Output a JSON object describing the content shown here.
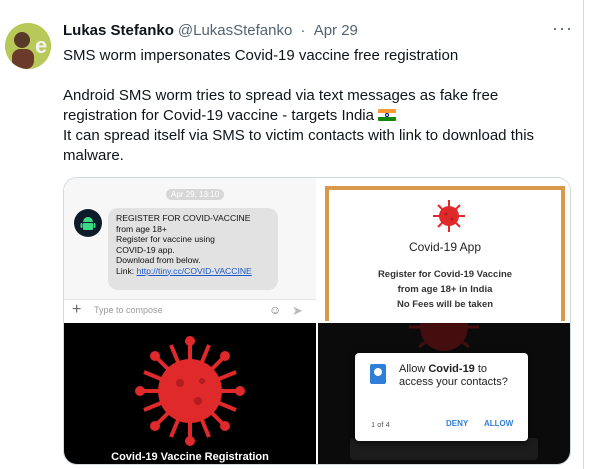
{
  "tweet": {
    "author_name": "Lukas Stefanko",
    "author_handle": "@LukasStefanko",
    "separator": "·",
    "date": "Apr 29",
    "more_icon": "ellipsis-icon",
    "text_line_1": "SMS worm impersonates Covid-19 vaccine free registration",
    "text_para_2_a": "Android SMS worm tries to spread via text messages as fake free registration for Covid-19 vaccine - targets India",
    "flag_icon": "india-flag-icon",
    "text_para_2_b": "It can spread itself via SMS to victim contacts with link to download this malware."
  },
  "media": {
    "sms": {
      "date": "Apr 29, 13:10",
      "lines": [
        "REGISTER FOR COVID-VACCINE",
        "from age 18+",
        "Register for vaccine using",
        "COVID-19 app.",
        "Download from below."
      ],
      "link_prefix": "Link: ",
      "link": "http://tiny.cc/COVID-VACCINE",
      "compose_placeholder": "Type to compose"
    },
    "app_poster": {
      "title": "Covid-19 App",
      "line_1": "Register for Covid-19 Vaccine",
      "line_2": "from age 18+ in India",
      "line_3": "No Fees will be taken"
    },
    "splash": {
      "caption": "Covid-19 Vaccine Registration"
    },
    "permission_dialog": {
      "text_before": "Allow ",
      "app_name": "Covid-19",
      "text_after": " to access your contacts?",
      "count": "1 of 4",
      "deny_label": "DENY",
      "allow_label": "ALLOW"
    }
  },
  "colors": {
    "accent": "#2f7fd8",
    "virus_red": "#e0292b",
    "poster_border": "#d89a4a",
    "link_blue": "#1a57c9"
  }
}
